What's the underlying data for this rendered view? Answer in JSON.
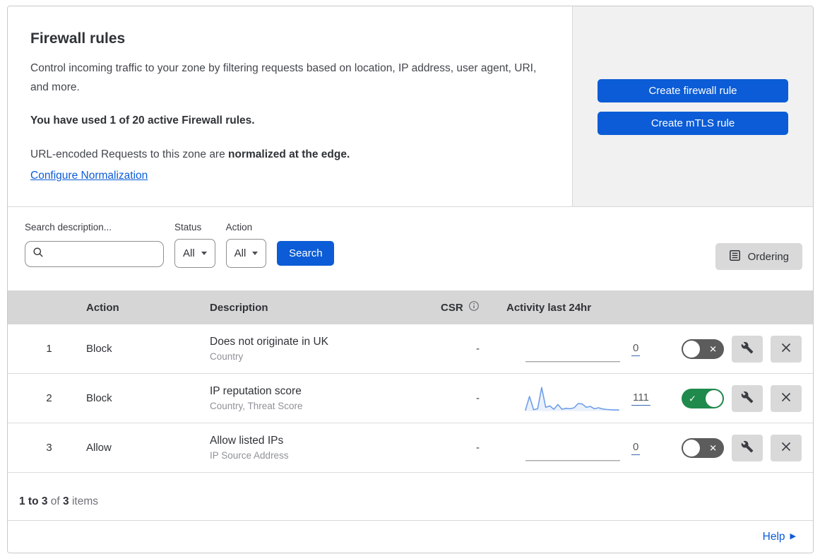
{
  "colors": {
    "accent_blue": "#0b5cd6",
    "toggle_on_green": "#1f8a4c",
    "toggle_off_gray": "#5c5c5c",
    "sparkline_blue": "#6e9ee8",
    "table_header_gray": "#d6d6d6",
    "side_panel_gray": "#f1f1f1"
  },
  "header": {
    "title": "Firewall rules",
    "description": "Control incoming traffic to your zone by filtering requests based on location, IP address, user agent, URI, and more.",
    "usage_bold": "You have used 1 of 20 active Firewall rules.",
    "normalization_prefix": "URL-encoded Requests to this zone are ",
    "normalization_bold": "normalized at the edge.",
    "normalization_link": "Configure Normalization",
    "create_firewall_button": "Create firewall rule",
    "create_mtls_button": "Create mTLS rule"
  },
  "filters": {
    "search_label": "Search description...",
    "status_label": "Status",
    "status_value": "All",
    "action_label": "Action",
    "action_value": "All",
    "search_button": "Search",
    "ordering_button": "Ordering"
  },
  "table": {
    "columns": {
      "action": "Action",
      "description": "Description",
      "csr": "CSR",
      "activity": "Activity last 24hr"
    },
    "rows": [
      {
        "priority": "1",
        "action": "Block",
        "description": "Does not originate in UK",
        "fields": "Country",
        "csr": "-",
        "activity_count": "0",
        "enabled": false,
        "sparkline": []
      },
      {
        "priority": "2",
        "action": "Block",
        "description": "IP reputation score",
        "fields": "Country, Threat Score",
        "csr": "-",
        "activity_count": "111",
        "enabled": true,
        "sparkline": [
          4,
          62,
          6,
          10,
          100,
          16,
          22,
          8,
          28,
          8,
          12,
          10,
          14,
          32,
          30,
          16,
          20,
          10,
          14,
          9,
          7,
          6,
          5,
          5
        ]
      },
      {
        "priority": "3",
        "action": "Allow",
        "description": "Allow listed IPs",
        "fields": "IP Source Address",
        "csr": "-",
        "activity_count": "0",
        "enabled": false,
        "sparkline": []
      }
    ]
  },
  "footer": {
    "range_bold": "1 to 3",
    "of_text": " of ",
    "total_bold": "3",
    "items_text": " items",
    "help_label": "Help"
  }
}
